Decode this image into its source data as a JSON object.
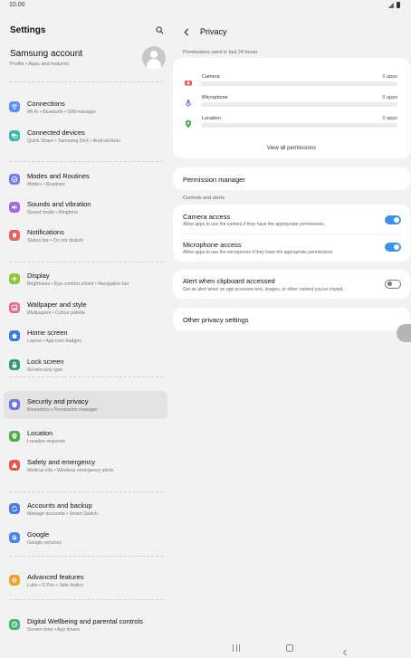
{
  "status": {
    "time": "10.00"
  },
  "left": {
    "title": "Settings",
    "account": {
      "name": "Samsung account",
      "subtitle": "Profile  •  Apps and features"
    },
    "items": [
      {
        "title": "Connections",
        "subtitle": "Wi-Fi  •  Bluetooth  •  SIM manager",
        "icon": "wifi-icon",
        "color": "#5a8ef0"
      },
      {
        "title": "Connected devices",
        "subtitle": "Quick Share  •  Samsung DeX  •  Android Auto",
        "icon": "connected-devices-icon",
        "color": "#3ab5a7"
      },
      {
        "title": "Modes and Routines",
        "subtitle": "Modes  •  Routines",
        "icon": "check-circle-icon",
        "color": "#6b7de8"
      },
      {
        "title": "Sounds and vibration",
        "subtitle": "Sound mode  •  Ringtone",
        "icon": "volume-icon",
        "color": "#a06ae0"
      },
      {
        "title": "Notifications",
        "subtitle": "Status bar  •  Do not disturb",
        "icon": "bell-icon",
        "color": "#e36464"
      },
      {
        "title": "Display",
        "subtitle": "Brightness  •  Eye comfort shield  •  Navigation bar",
        "icon": "sun-icon",
        "color": "#8cc63e"
      },
      {
        "title": "Wallpaper and style",
        "subtitle": "Wallpapers  •  Colour palette",
        "icon": "image-icon",
        "color": "#e06a96"
      },
      {
        "title": "Home screen",
        "subtitle": "Layout  •  App icon badges",
        "icon": "home-icon",
        "color": "#3b79e6"
      },
      {
        "title": "Lock screen",
        "subtitle": "Screen lock type",
        "icon": "lock-icon",
        "color": "#2e9a6c"
      },
      {
        "title": "Security and privacy",
        "subtitle": "Biometrics  •  Permission manager",
        "icon": "shield-icon",
        "color": "#6c75e6",
        "selected": true
      },
      {
        "title": "Location",
        "subtitle": "Location requests",
        "icon": "location-pin-icon",
        "color": "#4fae4a"
      },
      {
        "title": "Safety and emergency",
        "subtitle": "Medical info  •  Wireless emergency alerts",
        "icon": "alert-icon",
        "color": "#e2584f"
      },
      {
        "title": "Accounts and backup",
        "subtitle": "Manage accounts  •  Smart Switch",
        "icon": "sync-icon",
        "color": "#4b7be0"
      },
      {
        "title": "Google",
        "subtitle": "Google services",
        "icon": "google-icon",
        "color": "#4a86e8"
      },
      {
        "title": "Advanced features",
        "subtitle": "Labs  •  S Pen  •  Side button",
        "icon": "gear-star-icon",
        "color": "#eca32f"
      },
      {
        "title": "Digital Wellbeing and parental controls",
        "subtitle": "Screen time  •  App timers",
        "icon": "wellbeing-icon",
        "color": "#4bb26c"
      }
    ]
  },
  "right": {
    "title": "Privacy",
    "permissions_section_label": "Permissions used in last 24 hours",
    "permissions": [
      {
        "name": "Camera",
        "count": "0 apps",
        "icon": "camera-icon",
        "color": "#e85b5b"
      },
      {
        "name": "Microphone",
        "count": "0 apps",
        "icon": "microphone-icon",
        "color": "#6f79e6"
      },
      {
        "name": "Location",
        "count": "0 apps",
        "icon": "location-pin-icon",
        "color": "#4fae4a"
      }
    ],
    "view_all_label": "View all permissions",
    "permission_manager_label": "Permission manager",
    "controls_section_label": "Controls and alerts",
    "camera_access": {
      "title": "Camera access",
      "subtitle": "Allow apps to use the camera if they have the appropriate permissions.",
      "enabled": true
    },
    "microphone_access": {
      "title": "Microphone access",
      "subtitle": "Allow apps to use the microphone if they have the appropriate permissions.",
      "enabled": true
    },
    "clipboard_alert": {
      "title": "Alert when clipboard accessed",
      "subtitle": "Get an alert when an app accesses text, images, or other content you've copied.",
      "enabled": false
    },
    "other_privacy_label": "Other privacy settings"
  },
  "colors": {
    "accent": "#3e91e8",
    "selected_bg": "#e3e3e3",
    "background": "#f2f2f2"
  }
}
